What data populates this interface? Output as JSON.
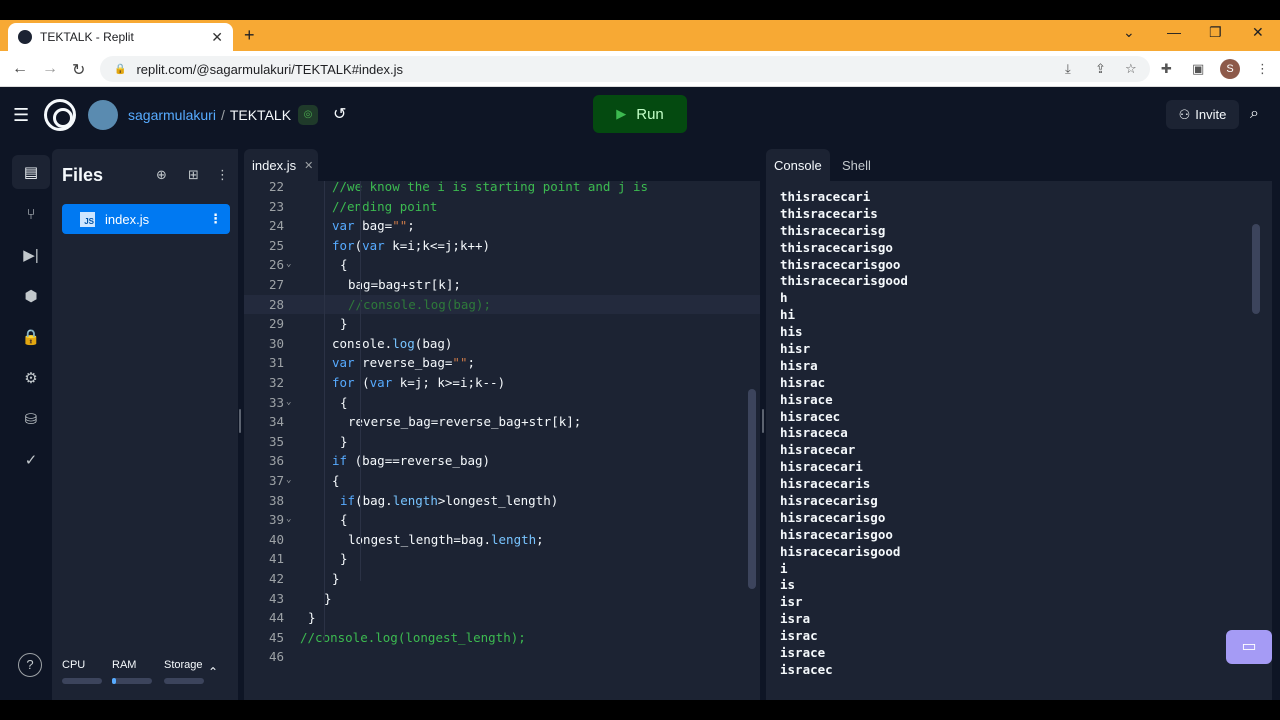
{
  "browser": {
    "tab_title": "TEKTALK - Replit",
    "tab_close": "✕",
    "new_tab": "+",
    "url": "replit.com/@sagarmulakuri/TEKTALK#index.js",
    "profile_initial": "S"
  },
  "header": {
    "username": "sagarmulakuri",
    "separator": "/",
    "repl_name": "TEKTALK",
    "run_label": "Run",
    "invite_label": "Invite"
  },
  "files": {
    "title": "Files",
    "items": [
      {
        "name": "index.js"
      }
    ],
    "resources": {
      "cpu": "CPU",
      "ram": "RAM",
      "storage": "Storage",
      "cpu_level": 0.0,
      "ram_level": 0.1,
      "storage_level": 0.0
    }
  },
  "editor": {
    "tab_name": "index.js",
    "highlighted_line": 28,
    "lines": [
      {
        "n": "22",
        "text": "//we know the i is starting point and j is"
      },
      {
        "n": "23",
        "text": "//ending point"
      },
      {
        "n": "24",
        "text": "var bag=\"\";"
      },
      {
        "n": "25",
        "text": "for(var k=i;k<=j;k++)"
      },
      {
        "n": "26",
        "text": "{"
      },
      {
        "n": "27",
        "text": "bag=bag+str[k];"
      },
      {
        "n": "28",
        "text": "//console.log(bag);"
      },
      {
        "n": "29",
        "text": "}"
      },
      {
        "n": "30",
        "text": "console.log(bag)"
      },
      {
        "n": "31",
        "text": "var reverse_bag=\"\";"
      },
      {
        "n": "32",
        "text": "for (var k=j; k>=i;k--)"
      },
      {
        "n": "33",
        "text": "{"
      },
      {
        "n": "34",
        "text": "reverse_bag=reverse_bag+str[k];"
      },
      {
        "n": "35",
        "text": "}"
      },
      {
        "n": "36",
        "text": "if (bag==reverse_bag)"
      },
      {
        "n": "37",
        "text": "{"
      },
      {
        "n": "38",
        "text": "if(bag.length>longest_length)"
      },
      {
        "n": "39",
        "text": "{"
      },
      {
        "n": "40",
        "text": "longest_length=bag.length;"
      },
      {
        "n": "41",
        "text": "}"
      },
      {
        "n": "42",
        "text": "}"
      },
      {
        "n": "43",
        "text": "}"
      },
      {
        "n": "44",
        "text": "}"
      },
      {
        "n": "45",
        "text": "//console.log(longest_length);"
      },
      {
        "n": "46",
        "text": ""
      }
    ]
  },
  "console": {
    "tabs": [
      "Console",
      "Shell"
    ],
    "output": [
      "thisracecari",
      "thisracecaris",
      "thisracecarisg",
      "thisracecarisgo",
      "thisracecarisgoo",
      "thisracecarisgood",
      "h",
      "hi",
      "his",
      "hisr",
      "hisra",
      "hisrac",
      "hisrace",
      "hisracec",
      "hisraceca",
      "hisracecar",
      "hisracecari",
      "hisracecaris",
      "hisracecarisg",
      "hisracecarisgo",
      "hisracecarisgoo",
      "hisracecarisgood",
      "i",
      "is",
      "isr",
      "isra",
      "israc",
      "israce",
      "isracec"
    ]
  }
}
